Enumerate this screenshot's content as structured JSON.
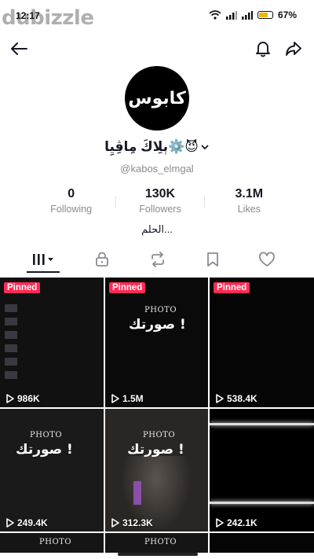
{
  "status": {
    "time": "12:17",
    "battery": "67%",
    "watermark": "dubizzle"
  },
  "profile": {
    "avatar_text": "كابوس",
    "display_name": "ٻلِاكَ مِاڤِيِا⚙️😈",
    "username": "@kabos_elmgal",
    "bio": "الحلم..."
  },
  "stats": [
    {
      "value": "0",
      "label": "Following"
    },
    {
      "value": "130K",
      "label": "Followers"
    },
    {
      "value": "3.1M",
      "label": "Likes"
    }
  ],
  "grid": {
    "pinned_label": "Pinned",
    "videos": [
      {
        "views": "986K",
        "pinned": true
      },
      {
        "views": "1.5M",
        "pinned": true,
        "caption_top": "PHOTO",
        "caption_main": "صورتك !"
      },
      {
        "views": "538.4K",
        "pinned": true
      },
      {
        "views": "249.4K",
        "pinned": false,
        "caption_top": "PHOTO",
        "caption_main": "صورتك !"
      },
      {
        "views": "312.3K",
        "pinned": false,
        "caption_top": "PHOTO",
        "caption_main": "صورتك !"
      },
      {
        "views": "242.1K",
        "pinned": false
      },
      {
        "views": "",
        "pinned": false,
        "caption_top": "PHOTO"
      },
      {
        "views": "",
        "pinned": false,
        "caption_top": "PHOTO"
      }
    ]
  },
  "icons": {
    "back": "back-arrow-icon",
    "bell": "bell-icon",
    "share": "share-icon",
    "tab_grid": "grid-icon",
    "tab_lock": "lock-icon",
    "tab_repost": "repost-icon",
    "tab_bookmark": "bookmark-icon",
    "tab_likes": "heart-icon"
  },
  "colors": {
    "pinned": "#fe2c55",
    "text": "#161823",
    "muted": "#8a8b91"
  }
}
